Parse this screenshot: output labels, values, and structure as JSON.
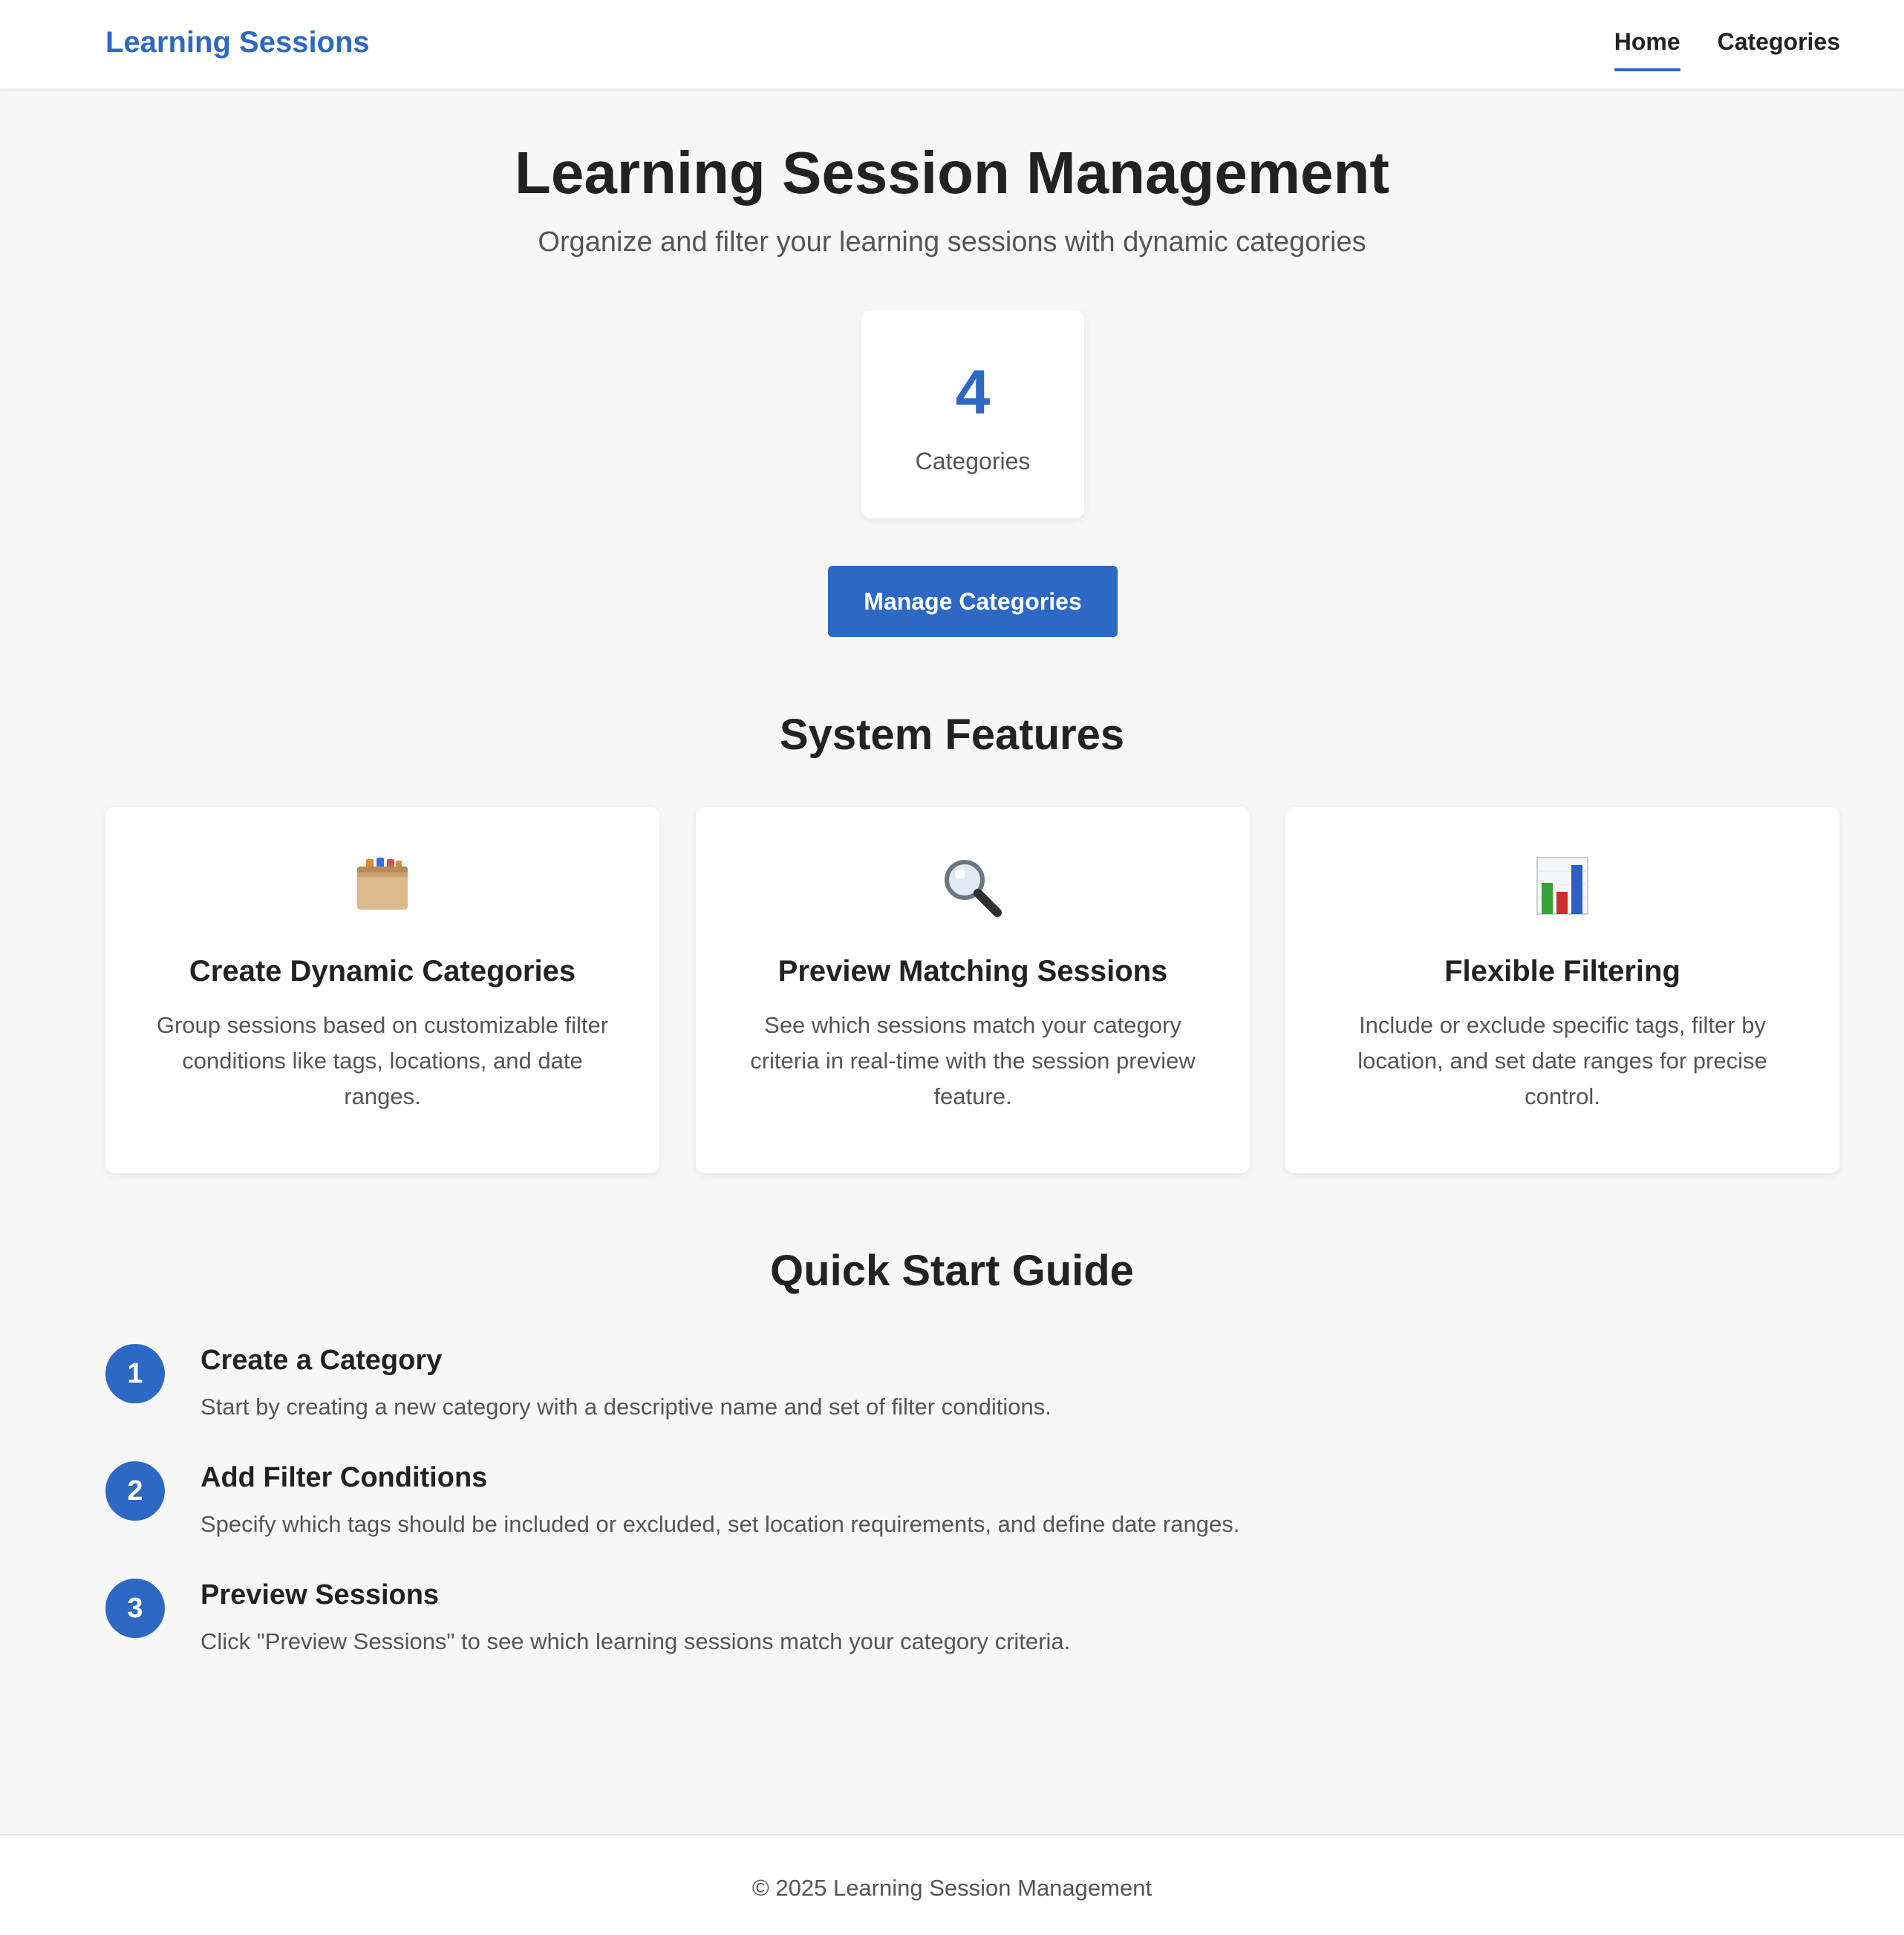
{
  "header": {
    "brand": "Learning Sessions",
    "nav": [
      {
        "label": "Home",
        "active": true
      },
      {
        "label": "Categories",
        "active": false
      }
    ]
  },
  "hero": {
    "title": "Learning Session Management",
    "subtitle": "Organize and filter your learning sessions with dynamic categories"
  },
  "stats": {
    "count": "4",
    "label": "Categories"
  },
  "actions": {
    "manage_label": "Manage Categories"
  },
  "features": {
    "title": "System Features",
    "items": [
      {
        "icon": "card-file-box-icon",
        "title": "Create Dynamic Categories",
        "description": "Group sessions based on customizable filter conditions like tags, locations, and date ranges."
      },
      {
        "icon": "magnifying-glass-icon",
        "title": "Preview Matching Sessions",
        "description": "See which sessions match your category criteria in real-time with the session preview feature."
      },
      {
        "icon": "bar-chart-icon",
        "title": "Flexible Filtering",
        "description": "Include or exclude specific tags, filter by location, and set date ranges for precise control."
      }
    ]
  },
  "guide": {
    "title": "Quick Start Guide",
    "steps": [
      {
        "number": "1",
        "title": "Create a Category",
        "description": "Start by creating a new category with a descriptive name and set of filter conditions."
      },
      {
        "number": "2",
        "title": "Add Filter Conditions",
        "description": "Specify which tags should be included or excluded, set location requirements, and define date ranges."
      },
      {
        "number": "3",
        "title": "Preview Sessions",
        "description": "Click \"Preview Sessions\" to see which learning sessions match your category criteria."
      }
    ]
  },
  "footer": {
    "text": "© 2025 Learning Session Management"
  },
  "colors": {
    "accent": "#2d68c4",
    "background": "#f7f7f8",
    "text": "#222222",
    "muted_text": "#555555"
  }
}
